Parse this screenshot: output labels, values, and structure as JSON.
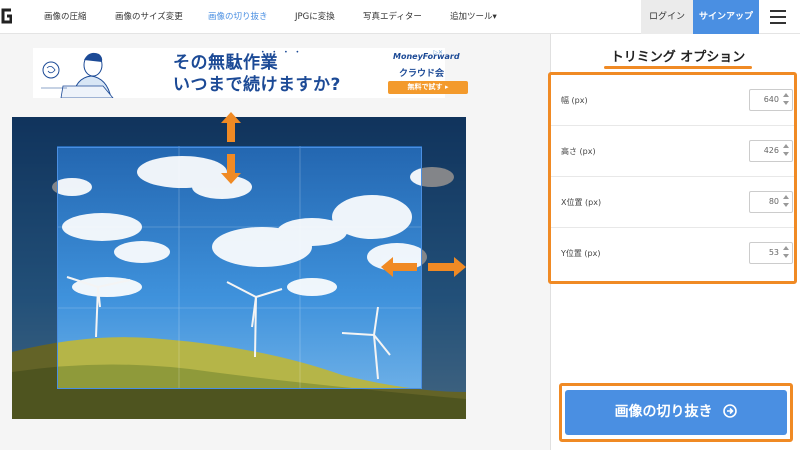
{
  "nav": {
    "items": [
      {
        "label": "画像の圧縮",
        "active": false
      },
      {
        "label": "画像のサイズ変更",
        "active": false
      },
      {
        "label": "画像の切り抜き",
        "active": true
      },
      {
        "label": "JPGに変換",
        "active": false
      },
      {
        "label": "写真エディター",
        "active": false
      },
      {
        "label": "追加ツール▾",
        "active": false
      }
    ],
    "login": "ログイン",
    "signup": "サインアップ",
    "menu_icon": "hamburger-icon",
    "accent": "#4a8fe2"
  },
  "ad": {
    "headline1": "その無駄作業",
    "headline2": "いつまで続けますか?",
    "brand": "MoneyForward",
    "sub": "クラウド会計",
    "cta": "無料で試す ▸"
  },
  "panel": {
    "title": "トリミング オプション",
    "options": [
      {
        "label": "幅 (px)",
        "value": "640"
      },
      {
        "label": "高さ (px)",
        "value": "426"
      },
      {
        "label": "X位置 (px)",
        "value": "80"
      },
      {
        "label": "Y位置 (px)",
        "value": "53"
      }
    ],
    "button": "画像の切り抜き"
  },
  "colors": {
    "highlight_orange": "#f08a24",
    "primary_blue": "#4a8fe2"
  }
}
